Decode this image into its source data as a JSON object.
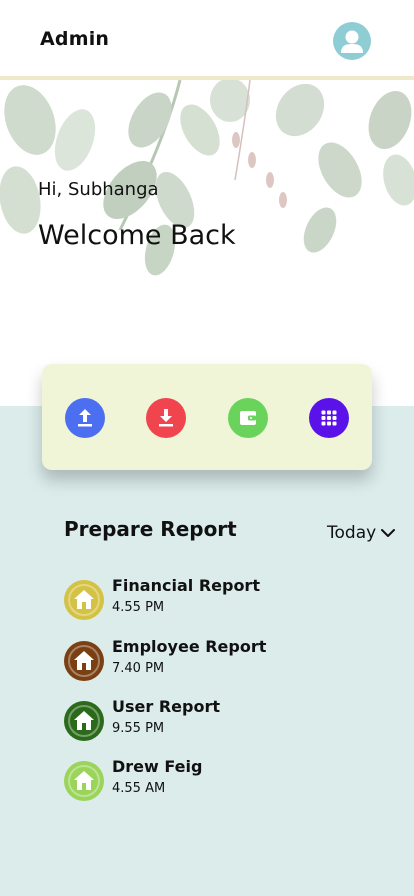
{
  "header": {
    "title": "Admin",
    "avatar_icon": "user-icon",
    "avatar_color": "#8fcdd5"
  },
  "hero": {
    "greeting": "Hi, Subhanga",
    "welcome": "Welcome Back"
  },
  "actions": [
    {
      "icon": "upload-icon",
      "color": "#4c6ef0"
    },
    {
      "icon": "download-icon",
      "color": "#f0454f"
    },
    {
      "icon": "wallet-icon",
      "color": "#6ad35b"
    },
    {
      "icon": "grid-icon",
      "color": "#5a12e8"
    }
  ],
  "reports": {
    "title": "Prepare Report",
    "period": "Today",
    "period_icon": "chevron-down-icon",
    "items": [
      {
        "name": "Financial Report",
        "time": "4.55 PM",
        "icon": "home-icon",
        "color": "#d4c244"
      },
      {
        "name": "Employee Report",
        "time": "7.40 PM",
        "icon": "home-icon",
        "color": "#7a3f12"
      },
      {
        "name": "User Report",
        "time": "9.55 PM",
        "icon": "home-icon",
        "color": "#2b6a1b"
      },
      {
        "name": "Drew Feig",
        "time": "4.55 AM",
        "icon": "home-icon",
        "color": "#9bd45a"
      }
    ]
  }
}
